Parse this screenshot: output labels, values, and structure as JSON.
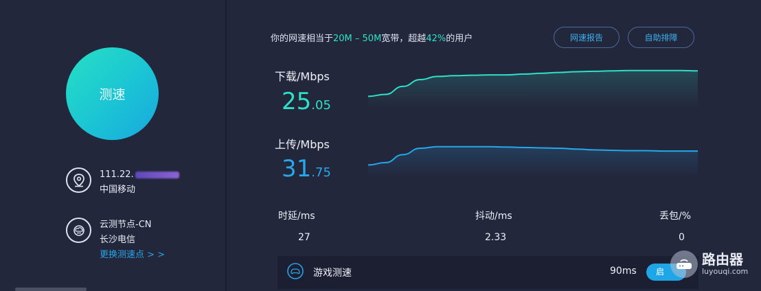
{
  "left": {
    "test_button_label": "测速",
    "ip": "111.22.",
    "isp": "中国移动",
    "node_name": "云测节点-CN",
    "node_location": "长沙电信",
    "change_node_link": "更换测速点 > >"
  },
  "summary": {
    "prefix": "你的网速相当于",
    "range": "20M – 50M",
    "middle": "宽带，超越",
    "percent": "42%",
    "suffix": "的用户"
  },
  "buttons": {
    "report": "网速报告",
    "ranking": "自助排障"
  },
  "download": {
    "label": "下载/Mbps",
    "value_int": "25",
    "value_frac": ".05",
    "color": "#2fe0c8",
    "curve": [
      0.2,
      0.25,
      0.45,
      0.62,
      0.7,
      0.72,
      0.73,
      0.74,
      0.74,
      0.76,
      0.78,
      0.8,
      0.82,
      0.83,
      0.84,
      0.85,
      0.85,
      0.85,
      0.85,
      0.84
    ]
  },
  "upload": {
    "label": "上传/Mbps",
    "value_int": "31",
    "value_frac": ".75",
    "color": "#26a8ec",
    "curve": [
      0.2,
      0.26,
      0.46,
      0.62,
      0.66,
      0.66,
      0.66,
      0.66,
      0.65,
      0.64,
      0.63,
      0.62,
      0.6,
      0.58,
      0.57,
      0.56,
      0.56,
      0.55,
      0.55,
      0.55
    ]
  },
  "stats": {
    "latency_label": "时延/ms",
    "latency_value": "27",
    "jitter_label": "抖动/ms",
    "jitter_value": "2.33",
    "loss_label": "丢包/%",
    "loss_value": "0"
  },
  "game": {
    "label": "游戏测速",
    "ms": "90ms",
    "toggle_label": "启"
  },
  "watermark": {
    "main": "路由器",
    "sub": "luyouqi.com"
  }
}
